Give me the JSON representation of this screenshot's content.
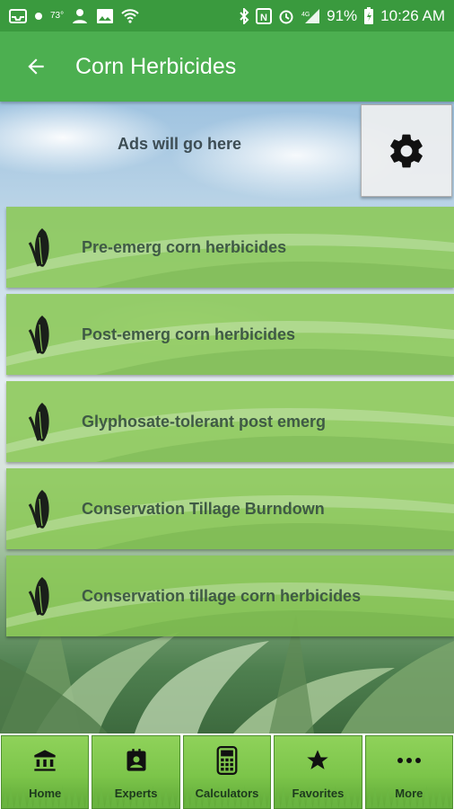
{
  "status_bar": {
    "temperature": "73°",
    "battery": "91%",
    "time": "10:26 AM",
    "icons": [
      "inbox-icon",
      "weather-icon",
      "user-icon",
      "image-icon",
      "wifi-icon",
      "bluetooth-icon",
      "nfc-icon",
      "alarm-icon",
      "signal-icon",
      "battery-icon"
    ]
  },
  "app_bar": {
    "title": "Corn Herbicides",
    "back_icon": "arrow-left-icon",
    "background_color": "#4caf50"
  },
  "ad": {
    "text": "Ads will go here"
  },
  "settings": {
    "icon": "gear-icon"
  },
  "menu": {
    "items": [
      {
        "label": "Pre-emerg corn herbicides",
        "icon": "corn-icon"
      },
      {
        "label": "Post-emerg corn herbicides",
        "icon": "corn-icon"
      },
      {
        "label": "Glyphosate-tolerant post emerg",
        "icon": "corn-icon"
      },
      {
        "label": "Conservation Tillage Burndown",
        "icon": "corn-icon"
      },
      {
        "label": "Conservation tillage corn herbicides",
        "icon": "corn-icon"
      }
    ]
  },
  "bottom_nav": {
    "items": [
      {
        "label": "Home",
        "icon": "bank-icon"
      },
      {
        "label": "Experts",
        "icon": "contact-card-icon"
      },
      {
        "label": "Calculators",
        "icon": "calculator-icon"
      },
      {
        "label": "Favorites",
        "icon": "star-icon"
      },
      {
        "label": "More",
        "icon": "more-dots-icon"
      }
    ]
  }
}
